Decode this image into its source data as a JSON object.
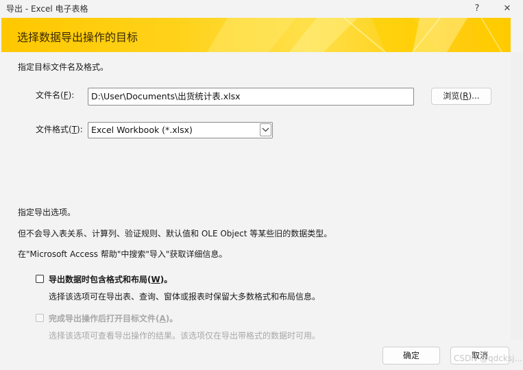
{
  "window": {
    "title": "导出 - Excel 电子表格",
    "help_glyph": "?",
    "close_glyph": "✕"
  },
  "banner": {
    "title": "选择数据导出操作的目标",
    "accent_color": "#ffc800"
  },
  "destination": {
    "instruction": "指定目标文件名及格式。",
    "file_name_label": "文件名(",
    "file_name_key": "F",
    "file_name_suffix": "):",
    "file_name_value": "D:\\User\\Documents\\出货统计表.xlsx",
    "browse_label": "浏览(",
    "browse_key": "R",
    "browse_suffix": ")...",
    "file_format_label": "文件格式(",
    "file_format_key": "T",
    "file_format_suffix": "):",
    "file_format_value": "Excel Workbook (*.xlsx)"
  },
  "options": {
    "heading": "指定导出选项。",
    "note": "但不会导入表关系、计算列、验证规则、默认值和 OLE Object 等某些旧的数据类型。",
    "help_hint": "在\"Microsoft Access 帮助\"中搜索\"导入\"获取详细信息。",
    "option1": {
      "label": "导出数据时包含格式和布局(",
      "key": "W",
      "suffix": ")。",
      "checked": false,
      "description": "选择该选项可在导出表、查询、窗体或报表时保留大多数格式和布局信息。"
    },
    "option2": {
      "label": "完成导出操作后打开目标文件(",
      "key": "A",
      "suffix": ")。",
      "checked": false,
      "enabled": false,
      "description": "选择该选项可查看导出操作的结果。该选项仅在导出带格式的数据时可用。"
    }
  },
  "footer": {
    "ok_label": "确定",
    "cancel_label": "取消",
    "watermark": "CSDN @qdcksj..."
  },
  "icons": {
    "close": "close-icon",
    "help": "help-icon",
    "dropdown": "chevron-down-icon"
  }
}
